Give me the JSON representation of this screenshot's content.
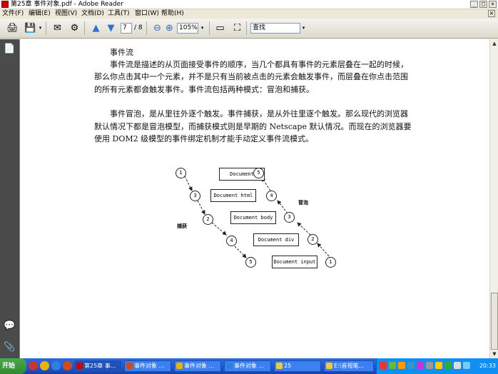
{
  "window": {
    "title": "第25章 事件对象.pdf - Adobe Reader",
    "buttons": {
      "minimize": "_",
      "maximize": "□",
      "close": "×"
    }
  },
  "menu": {
    "items": [
      "文件(F)",
      "编辑(E)",
      "视图(V)",
      "文档(D)",
      "工具(T)",
      "窗口(W)",
      "帮助(H)"
    ],
    "close_doc": "×"
  },
  "toolbar": {
    "print_icon": "🖨",
    "save_icon": "💾",
    "email_icon": "✉",
    "organize_icon": "⚙",
    "prev_page_icon": "▲",
    "next_page_icon": "▼",
    "page_current": "7",
    "page_total": "/ 8",
    "zoom_out_icon": "⊖",
    "zoom_in_icon": "⊕",
    "zoom_value": "105%",
    "fit_page_icon": "▭",
    "fullscreen_icon": "⛶",
    "search_value": "查找"
  },
  "nav": {
    "pages_icon": "📄",
    "comment_icon": "💬",
    "attach_icon": "📎"
  },
  "document": {
    "heading": "事件流",
    "paragraph1": [
      "事件流是描述的从页面接受事件的顺序，当几个都具有事件的元素层叠在一起的时候，",
      "那么你点击其中一个元素，并不是只有当前被点击的元素会触发事件，而层叠在你点击范围",
      "的所有元素都会触发事件。事件流包括两种模式：冒泡和捕获。"
    ],
    "paragraph2": [
      "事件冒泡，是从里往外逐个触发。事件捕获，是从外往里逐个触发。那么现代的浏览器",
      "默认情况下都是冒泡模型，而捕获模式则是早期的 Netscape 默认情况。而现在的浏览器要",
      "使用 DOM2 级模型的事件绑定机制才能手动定义事件流模式。"
    ]
  },
  "diagram": {
    "boxes": [
      "Document",
      "Document html",
      "Document body",
      "Document div",
      "Document input"
    ],
    "capture_label": "捕获",
    "bubble_label": "冒泡",
    "capture_nodes": [
      "1",
      "3",
      "2",
      "4",
      "5"
    ],
    "bubble_nodes": [
      "5",
      "4",
      "3",
      "2",
      "1"
    ]
  },
  "taskbar": {
    "start": "开始",
    "tasks": [
      "第25章 事...",
      "事件对象 ...",
      "事件对象 ...",
      "事件对象 ...",
      "25",
      "E:\\音视笔..."
    ],
    "clock": "20:33"
  }
}
